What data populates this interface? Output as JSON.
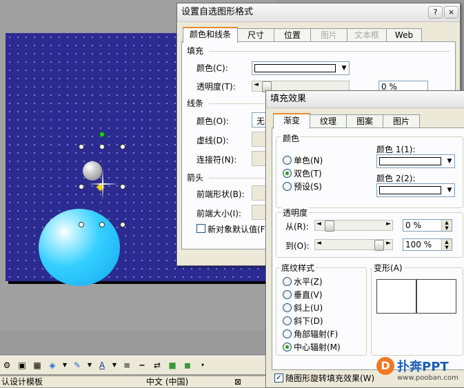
{
  "statusbar": {
    "template": "认设计模板",
    "language": "中文 (中国)"
  },
  "format_dialog": {
    "title": "设置自选图形格式",
    "help_label": "?",
    "close_label": "×",
    "tabs": [
      "颜色和线条",
      "尺寸",
      "位置",
      "图片",
      "文本框",
      "Web"
    ],
    "fill_section": "填充",
    "fill_color_label": "颜色(C):",
    "transparency_label": "透明度(T):",
    "transparency_value": "0 %",
    "line_section": "线条",
    "line_color_label": "颜色(O):",
    "line_color_value": "无",
    "dashed_label": "虚线(D):",
    "connector_label": "连接符(N):",
    "arrow_section": "箭头",
    "begin_style_label": "前端形状(B):",
    "begin_size_label": "前端大小(I):",
    "default_checkbox_label": "新对象默认值(F"
  },
  "fill_dialog": {
    "title": "填充效果",
    "tabs": [
      "渐变",
      "纹理",
      "图案",
      "图片"
    ],
    "colors_section": "颜色",
    "color_options": [
      "单色(N)",
      "双色(T)",
      "预设(S)"
    ],
    "color_selected": "双色(T)",
    "color1_label": "颜色 1(1):",
    "color2_label": "颜色 2(2):",
    "transparency_section": "透明度",
    "from_label": "从(R):",
    "from_value": "0 %",
    "from_fraction": 0.0,
    "to_label": "到(O):",
    "to_value": "100 %",
    "to_fraction": 1.0,
    "shading_section": "底纹样式",
    "shading_options": [
      "水平(Z)",
      "垂直(V)",
      "斜上(U)",
      "斜下(D)",
      "角部辐射(F)",
      "中心辐射(M)"
    ],
    "shading_selected": "中心辐射(M)",
    "variants_section": "变形(A)",
    "rotate_checkbox_label": "随图形旋转填充效果(W)",
    "rotate_checked": true
  },
  "watermark": {
    "brand": "扑奔PPT",
    "url": "www.pooban.com",
    "logo_letter": "D"
  }
}
